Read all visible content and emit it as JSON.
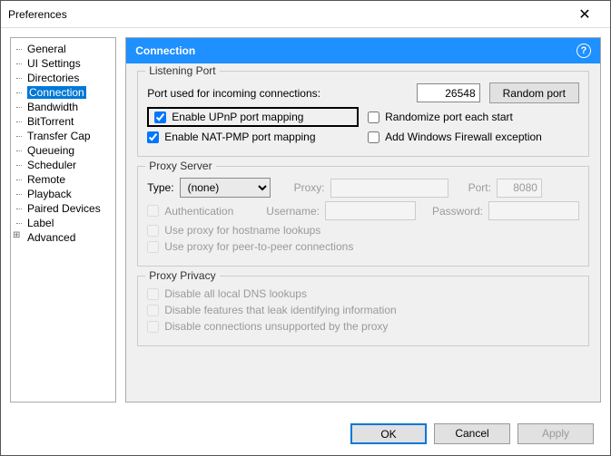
{
  "window": {
    "title": "Preferences"
  },
  "sidebar": {
    "items": [
      {
        "label": "General"
      },
      {
        "label": "UI Settings"
      },
      {
        "label": "Directories"
      },
      {
        "label": "Connection"
      },
      {
        "label": "Bandwidth"
      },
      {
        "label": "BitTorrent"
      },
      {
        "label": "Transfer Cap"
      },
      {
        "label": "Queueing"
      },
      {
        "label": "Scheduler"
      },
      {
        "label": "Remote"
      },
      {
        "label": "Playback"
      },
      {
        "label": "Paired Devices"
      },
      {
        "label": "Label"
      },
      {
        "label": "Advanced"
      }
    ]
  },
  "header": {
    "title": "Connection",
    "help": "?"
  },
  "listening": {
    "group": "Listening Port",
    "port_label": "Port used for incoming connections:",
    "port_value": "26548",
    "random_btn": "Random port",
    "upnp": "Enable UPnP port mapping",
    "natpmp": "Enable NAT-PMP port mapping",
    "randomize": "Randomize port each start",
    "firewall": "Add Windows Firewall exception"
  },
  "proxy": {
    "group": "Proxy Server",
    "type_label": "Type:",
    "type_value": "(none)",
    "proxy_label": "Proxy:",
    "port_label": "Port:",
    "port_value": "8080",
    "auth": "Authentication",
    "user_label": "Username:",
    "pass_label": "Password:",
    "hostname": "Use proxy for hostname lookups",
    "p2p": "Use proxy for peer-to-peer connections"
  },
  "privacy": {
    "group": "Proxy Privacy",
    "dns": "Disable all local DNS lookups",
    "leak": "Disable features that leak identifying information",
    "unsupported": "Disable connections unsupported by the proxy"
  },
  "footer": {
    "ok": "OK",
    "cancel": "Cancel",
    "apply": "Apply"
  }
}
